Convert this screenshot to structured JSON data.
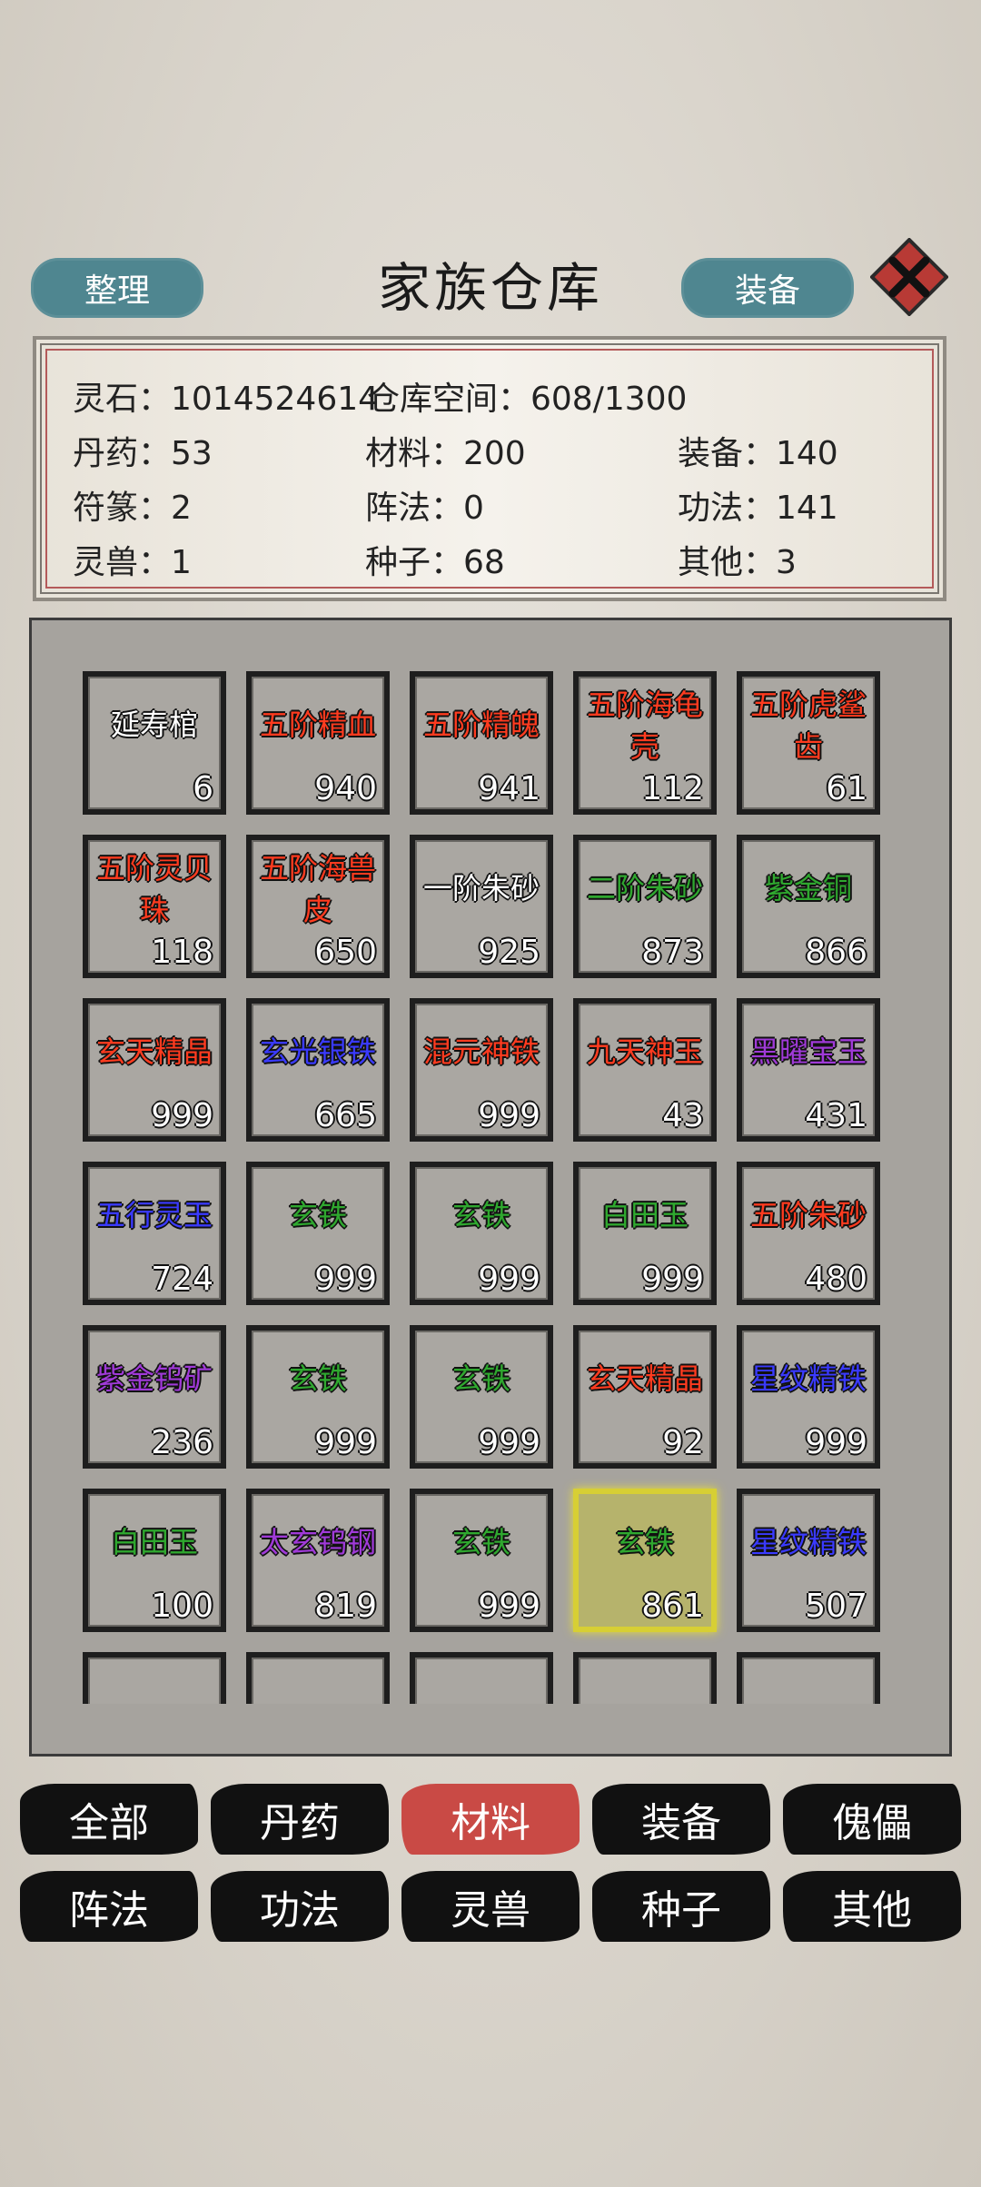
{
  "header": {
    "title": "家族仓库",
    "left_button": "整理",
    "right_button": "装备",
    "close_icon": "close-x-icon"
  },
  "stats": {
    "spirit_stone": "灵石：1014524614",
    "capacity": "仓库空间：608/1300",
    "pills": "丹药：53",
    "materials": "材料：200",
    "equipment": "装备：140",
    "talismans": "符篆：2",
    "formations": "阵法：0",
    "techniques": "功法：141",
    "beasts": "灵兽：1",
    "seeds": "种子：68",
    "others": "其他：3"
  },
  "items": [
    {
      "name": "延寿棺",
      "qty": "6",
      "color": "#ffffff"
    },
    {
      "name": "五阶精血",
      "qty": "940",
      "color": "#ff3b1f"
    },
    {
      "name": "五阶精魄",
      "qty": "941",
      "color": "#ff3b1f"
    },
    {
      "name": "五阶海龟壳",
      "qty": "112",
      "color": "#ff3b1f"
    },
    {
      "name": "五阶虎鲨齿",
      "qty": "61",
      "color": "#ff3b1f"
    },
    {
      "name": "五阶灵贝珠",
      "qty": "118",
      "color": "#ff3b1f"
    },
    {
      "name": "五阶海兽皮",
      "qty": "650",
      "color": "#ff3b1f"
    },
    {
      "name": "一阶朱砂",
      "qty": "925",
      "color": "#ffffff"
    },
    {
      "name": "二阶朱砂",
      "qty": "873",
      "color": "#2fa82f"
    },
    {
      "name": "紫金铜",
      "qty": "866",
      "color": "#2fa82f"
    },
    {
      "name": "玄天精晶",
      "qty": "999",
      "color": "#ff3b1f"
    },
    {
      "name": "玄光银铁",
      "qty": "665",
      "color": "#3a3aff"
    },
    {
      "name": "混元神铁",
      "qty": "999",
      "color": "#ff3b1f"
    },
    {
      "name": "九天神玉",
      "qty": "43",
      "color": "#ff3b1f"
    },
    {
      "name": "黑曜宝玉",
      "qty": "431",
      "color": "#a03ad8"
    },
    {
      "name": "五行灵玉",
      "qty": "724",
      "color": "#3a3aff"
    },
    {
      "name": "玄铁",
      "qty": "999",
      "color": "#2fa82f"
    },
    {
      "name": "玄铁",
      "qty": "999",
      "color": "#2fa82f"
    },
    {
      "name": "白田玉",
      "qty": "999",
      "color": "#2fa82f"
    },
    {
      "name": "五阶朱砂",
      "qty": "480",
      "color": "#ff3b1f"
    },
    {
      "name": "紫金钨矿",
      "qty": "236",
      "color": "#a03ad8"
    },
    {
      "name": "玄铁",
      "qty": "999",
      "color": "#2fa82f"
    },
    {
      "name": "玄铁",
      "qty": "999",
      "color": "#2fa82f"
    },
    {
      "name": "玄天精晶",
      "qty": "92",
      "color": "#ff3b1f"
    },
    {
      "name": "星纹精铁",
      "qty": "999",
      "color": "#3a3aff"
    },
    {
      "name": "白田玉",
      "qty": "100",
      "color": "#2fa82f"
    },
    {
      "name": "太玄钨钢",
      "qty": "819",
      "color": "#a03ad8"
    },
    {
      "name": "玄铁",
      "qty": "999",
      "color": "#2fa82f"
    },
    {
      "name": "玄铁",
      "qty": "861",
      "color": "#2fa82f",
      "selected": true
    },
    {
      "name": "星纹精铁",
      "qty": "507",
      "color": "#3a3aff"
    },
    {
      "name": "",
      "qty": "",
      "color": "#ffffff"
    },
    {
      "name": "",
      "qty": "",
      "color": "#ffffff"
    },
    {
      "name": "",
      "qty": "",
      "color": "#ffffff"
    },
    {
      "name": "",
      "qty": "",
      "color": "#ffffff"
    },
    {
      "name": "",
      "qty": "",
      "color": "#ffffff"
    }
  ],
  "tabs": [
    {
      "label": "全部",
      "active": false
    },
    {
      "label": "丹药",
      "active": false
    },
    {
      "label": "材料",
      "active": true
    },
    {
      "label": "装备",
      "active": false
    },
    {
      "label": "傀儡",
      "active": false
    },
    {
      "label": "阵法",
      "active": false
    },
    {
      "label": "功法",
      "active": false
    },
    {
      "label": "灵兽",
      "active": false
    },
    {
      "label": "种子",
      "active": false
    },
    {
      "label": "其他",
      "active": false
    }
  ]
}
